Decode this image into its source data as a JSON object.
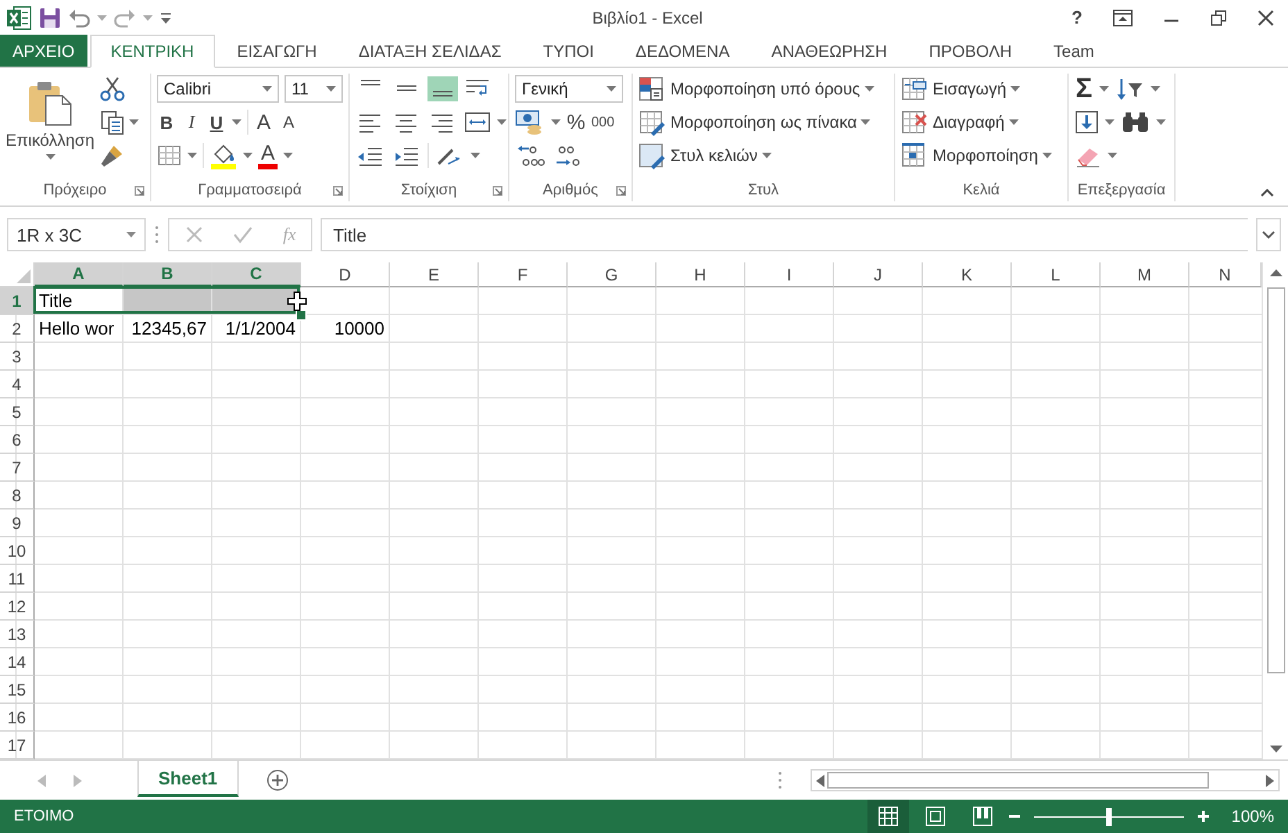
{
  "window": {
    "title": "Βιβλίο1 - Excel",
    "help": "?"
  },
  "tabs": [
    {
      "label": "ΑΡΧΕΙΟ",
      "kind": "file",
      "selected": false
    },
    {
      "label": "ΚΕΝΤΡΙΚΗ",
      "kind": "tab",
      "selected": true
    },
    {
      "label": "ΕΙΣΑΓΩΓΗ",
      "kind": "tab",
      "selected": false
    },
    {
      "label": "ΔΙΑΤΑΞΗ ΣΕΛΙΔΑΣ",
      "kind": "tab",
      "selected": false
    },
    {
      "label": "ΤΥΠΟΙ",
      "kind": "tab",
      "selected": false
    },
    {
      "label": "ΔΕΔΟΜΕΝΑ",
      "kind": "tab",
      "selected": false
    },
    {
      "label": "ΑΝΑΘΕΩΡΗΣΗ",
      "kind": "tab",
      "selected": false
    },
    {
      "label": "ΠΡΟΒΟΛΗ",
      "kind": "tab",
      "selected": false
    },
    {
      "label": "Team",
      "kind": "tab",
      "selected": false
    }
  ],
  "ribbon": {
    "groups": [
      {
        "kind": "clipboard",
        "label": "Πρόχειρο",
        "paste": "Επικόλληση"
      },
      {
        "kind": "font",
        "label": "Γραμματοσειρά",
        "font": "Calibri",
        "size": "11",
        "bold": "B",
        "italic": "I",
        "underline": "U",
        "grow_font": "A",
        "shrink_font": "A",
        "font_color": "A"
      },
      {
        "kind": "alignment",
        "label": "Στοίχιση",
        "vertical": [
          {
            "kind": "top",
            "selected": false
          },
          {
            "kind": "middle",
            "selected": false
          },
          {
            "kind": "bottom",
            "selected": true
          }
        ]
      },
      {
        "kind": "number",
        "label": "Αριθμός",
        "format": "Γενική",
        "percent": "%",
        "thousands": "000"
      },
      {
        "kind": "styles",
        "label": "Στυλ",
        "commands": [
          "Μορφοποίηση υπό όρους",
          "Μορφοποίηση ως πίνακα",
          "Στυλ κελιών"
        ]
      },
      {
        "kind": "cells",
        "label": "Κελιά",
        "commands": [
          "Εισαγωγή",
          "Διαγραφή",
          "Μορφοποίηση"
        ]
      },
      {
        "kind": "editing",
        "label": "Επεξεργασία",
        "autosum": "Σ"
      }
    ]
  },
  "formula_bar": {
    "name_box": "1R x 3C",
    "insert_function": "fx",
    "value": "Title"
  },
  "sheet": {
    "columns": [
      {
        "label": "A",
        "selected": true
      },
      {
        "label": "B",
        "selected": true
      },
      {
        "label": "C",
        "selected": true
      },
      {
        "label": "D",
        "selected": false
      },
      {
        "label": "E",
        "selected": false
      },
      {
        "label": "F",
        "selected": false
      },
      {
        "label": "G",
        "selected": false
      },
      {
        "label": "H",
        "selected": false
      },
      {
        "label": "I",
        "selected": false
      },
      {
        "label": "J",
        "selected": false
      },
      {
        "label": "K",
        "selected": false
      },
      {
        "label": "L",
        "selected": false
      },
      {
        "label": "M",
        "selected": false
      },
      {
        "label": "N",
        "selected": false
      }
    ],
    "rows": [
      {
        "header": "1",
        "selected": true,
        "cells": [
          {
            "text": "Title",
            "align_right": false
          }
        ]
      },
      {
        "header": "2",
        "selected": false,
        "cells": [
          {
            "text": "Hello wor",
            "align_right": false
          },
          {
            "text": "12345,67",
            "align_right": true
          },
          {
            "text": "1/1/2004",
            "align_right": true
          },
          {
            "text": "10000",
            "align_right": true
          }
        ]
      },
      {
        "header": "3",
        "selected": false
      },
      {
        "header": "4",
        "selected": false
      },
      {
        "header": "5",
        "selected": false
      },
      {
        "header": "6",
        "selected": false
      },
      {
        "header": "7",
        "selected": false
      },
      {
        "header": "8",
        "selected": false
      },
      {
        "header": "9",
        "selected": false
      },
      {
        "header": "10",
        "selected": false
      },
      {
        "header": "11",
        "selected": false
      },
      {
        "header": "12",
        "selected": false
      },
      {
        "header": "13",
        "selected": false
      },
      {
        "header": "14",
        "selected": false
      },
      {
        "header": "15",
        "selected": false
      },
      {
        "header": "16",
        "selected": false
      },
      {
        "header": "17",
        "selected": false
      }
    ]
  },
  "sheet_tabs": [
    {
      "label": "Sheet1",
      "selected": true
    }
  ],
  "status_bar": {
    "mode": "ΕΤΟΙΜΟ",
    "views": [
      {
        "kind": "normal",
        "selected": true
      },
      {
        "kind": "page_layout",
        "selected": false
      },
      {
        "kind": "page_break",
        "selected": false
      }
    ],
    "zoom": {
      "level": 0.5,
      "reading": "100%"
    }
  }
}
